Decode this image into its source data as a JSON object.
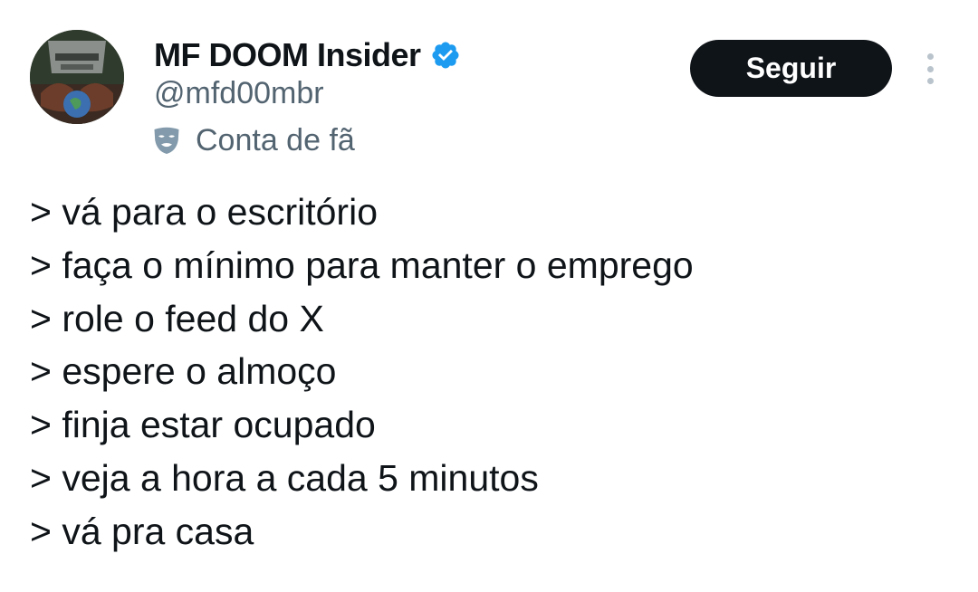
{
  "author": {
    "display_name": "MF DOOM Insider",
    "handle": "@mfd00mbr",
    "label": "Conta de fã",
    "verified_icon": "verified-badge-icon",
    "label_icon": "mask-icon",
    "avatar": "avatar-image"
  },
  "actions": {
    "follow_label": "Seguir",
    "more_icon": "more-options-icon"
  },
  "tweet": {
    "lines": [
      "> vá para o escritório",
      "> faça o mínimo para manter o emprego",
      "> role o feed do X",
      "> espere o almoço",
      "> finja estar ocupado",
      "> veja a hora a cada 5 minutos",
      "> vá pra casa"
    ]
  },
  "colors": {
    "text_primary": "#0f1419",
    "text_secondary": "#536471",
    "verified_blue": "#1d9bf0",
    "button_bg": "#0f1419",
    "button_text": "#ffffff"
  }
}
